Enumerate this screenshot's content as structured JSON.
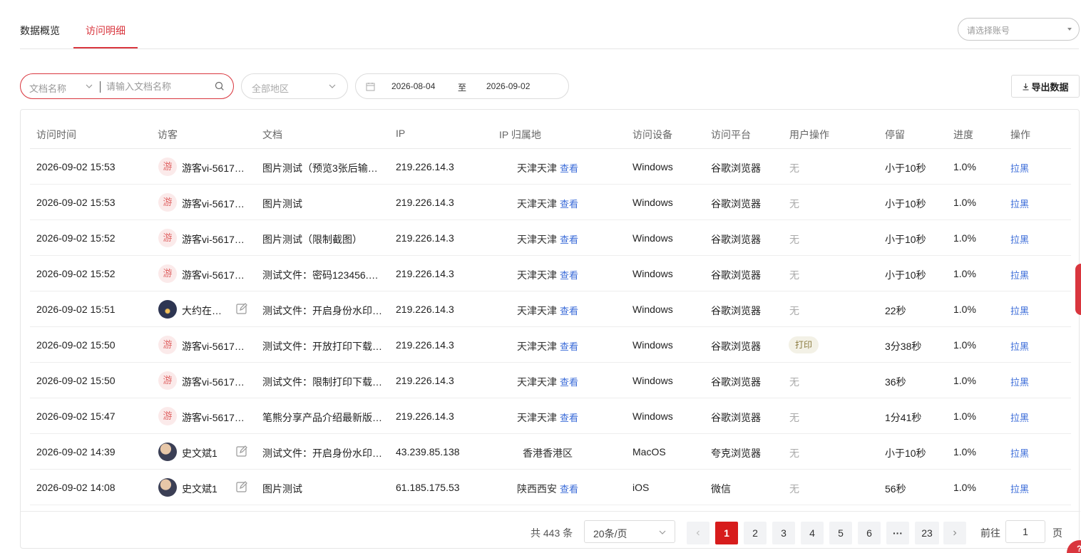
{
  "tabs": [
    {
      "label": "数据概览",
      "active": false
    },
    {
      "label": "访问明细",
      "active": true
    }
  ],
  "account_select": {
    "placeholder": "请选择账号"
  },
  "filters": {
    "doc_type": "文档名称",
    "doc_placeholder": "请输入文档名称",
    "region_placeholder": "全部地区",
    "date_start": "2026-08-04",
    "date_sep": "至",
    "date_end": "2026-09-02",
    "export_label": "导出数据"
  },
  "columns": [
    "访问时间",
    "访客",
    "文档",
    "IP",
    "IP 归属地",
    "访问设备",
    "访问平台",
    "用户操作",
    "停留",
    "进度",
    "操作"
  ],
  "rows": [
    {
      "time": "2026-09-02 15:53",
      "visitor": "游客vi-5617…",
      "guest": true,
      "doc": "图片测试（预览3张后输…",
      "ip": "219.226.14.3",
      "location": "天津天津",
      "view": "查看",
      "device": "Windows",
      "platform": "谷歌浏览器",
      "action": "无",
      "stay": "小于10秒",
      "progress": "1.0%",
      "op": "拉黑"
    },
    {
      "time": "2026-09-02 15:53",
      "visitor": "游客vi-5617…",
      "guest": true,
      "doc": "图片测试",
      "ip": "219.226.14.3",
      "location": "天津天津",
      "view": "查看",
      "device": "Windows",
      "platform": "谷歌浏览器",
      "action": "无",
      "stay": "小于10秒",
      "progress": "1.0%",
      "op": "拉黑"
    },
    {
      "time": "2026-09-02 15:52",
      "visitor": "游客vi-5617…",
      "guest": true,
      "doc": "图片测试（限制截图）",
      "ip": "219.226.14.3",
      "location": "天津天津",
      "view": "查看",
      "device": "Windows",
      "platform": "谷歌浏览器",
      "action": "无",
      "stay": "小于10秒",
      "progress": "1.0%",
      "op": "拉黑"
    },
    {
      "time": "2026-09-02 15:52",
      "visitor": "游客vi-5617…",
      "guest": true,
      "doc": "测试文件：密码123456.…",
      "ip": "219.226.14.3",
      "location": "天津天津",
      "view": "查看",
      "device": "Windows",
      "platform": "谷歌浏览器",
      "action": "无",
      "stay": "小于10秒",
      "progress": "1.0%",
      "op": "拉黑"
    },
    {
      "time": "2026-09-02 15:51",
      "visitor": "大约在…",
      "guest": false,
      "avatar": "night",
      "editable": true,
      "doc": "测试文件：开启身份水印…",
      "ip": "219.226.14.3",
      "location": "天津天津",
      "view": "查看",
      "device": "Windows",
      "platform": "谷歌浏览器",
      "action": "无",
      "stay": "22秒",
      "progress": "1.0%",
      "op": "拉黑"
    },
    {
      "time": "2026-09-02 15:50",
      "visitor": "游客vi-5617…",
      "guest": true,
      "doc": "测试文件：开放打印下载…",
      "ip": "219.226.14.3",
      "location": "天津天津",
      "view": "查看",
      "device": "Windows",
      "platform": "谷歌浏览器",
      "action": "打印",
      "action_tag": true,
      "stay": "3分38秒",
      "progress": "1.0%",
      "op": "拉黑"
    },
    {
      "time": "2026-09-02 15:50",
      "visitor": "游客vi-5617…",
      "guest": true,
      "doc": "测试文件：限制打印下载…",
      "ip": "219.226.14.3",
      "location": "天津天津",
      "view": "查看",
      "device": "Windows",
      "platform": "谷歌浏览器",
      "action": "无",
      "stay": "36秒",
      "progress": "1.0%",
      "op": "拉黑"
    },
    {
      "time": "2026-09-02 15:47",
      "visitor": "游客vi-5617…",
      "guest": true,
      "doc": "笔熊分享产品介绍最新版…",
      "ip": "219.226.14.3",
      "location": "天津天津",
      "view": "查看",
      "device": "Windows",
      "platform": "谷歌浏览器",
      "action": "无",
      "stay": "1分41秒",
      "progress": "1.0%",
      "op": "拉黑"
    },
    {
      "time": "2026-09-02 14:39",
      "visitor": "史文斌1",
      "guest": false,
      "avatar": "person",
      "editable": true,
      "doc": "测试文件：开启身份水印…",
      "ip": "43.239.85.138",
      "location": "香港香港区",
      "view": "",
      "device": "MacOS",
      "platform": "夸克浏览器",
      "action": "无",
      "stay": "小于10秒",
      "progress": "1.0%",
      "op": "拉黑"
    },
    {
      "time": "2026-09-02 14:08",
      "visitor": "史文斌1",
      "guest": false,
      "avatar": "person",
      "editable": true,
      "doc": "图片测试",
      "ip": "61.185.175.53",
      "location": "陕西西安",
      "view": "查看",
      "device": "iOS",
      "platform": "微信",
      "action": "无",
      "stay": "56秒",
      "progress": "1.0%",
      "op": "拉黑"
    }
  ],
  "guest_badge": "游",
  "pagination": {
    "total": "共 443 条",
    "page_size": "20条/页",
    "pages": [
      "1",
      "2",
      "3",
      "4",
      "5",
      "6",
      "···",
      "23"
    ],
    "current": "1",
    "goto_prefix": "前往",
    "goto_value": "1",
    "goto_suffix": "页"
  },
  "help_bubble": "?",
  "colors": {
    "accent": "#d9363e",
    "link": "#3a6bd8"
  }
}
